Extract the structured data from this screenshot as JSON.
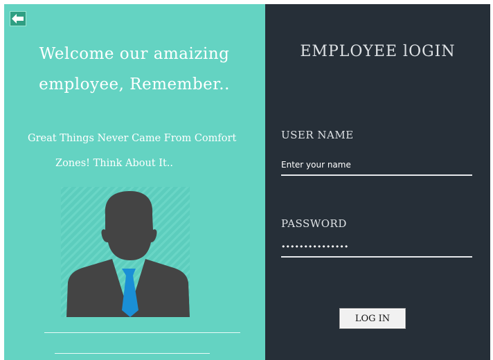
{
  "left_panel": {
    "welcome_line1": "Welcome our amaizing",
    "welcome_line2": "employee, Remember..",
    "quote_line1": "Great Things Never Came From Comfort",
    "quote_line2": "Zones! Think About It..",
    "back_icon": "back-arrow-icon",
    "avatar_icon": "employee-avatar-icon",
    "bg_color": "#64d3c2"
  },
  "login_panel": {
    "title": "EMPLOYEE lOGIN",
    "username_label": "USER NAME",
    "username_placeholder": "Enter your name",
    "password_label": "PASSWORD",
    "password_value": "•••••••••••••••",
    "login_button": "LOG IN",
    "bg_color": "#262f38"
  }
}
